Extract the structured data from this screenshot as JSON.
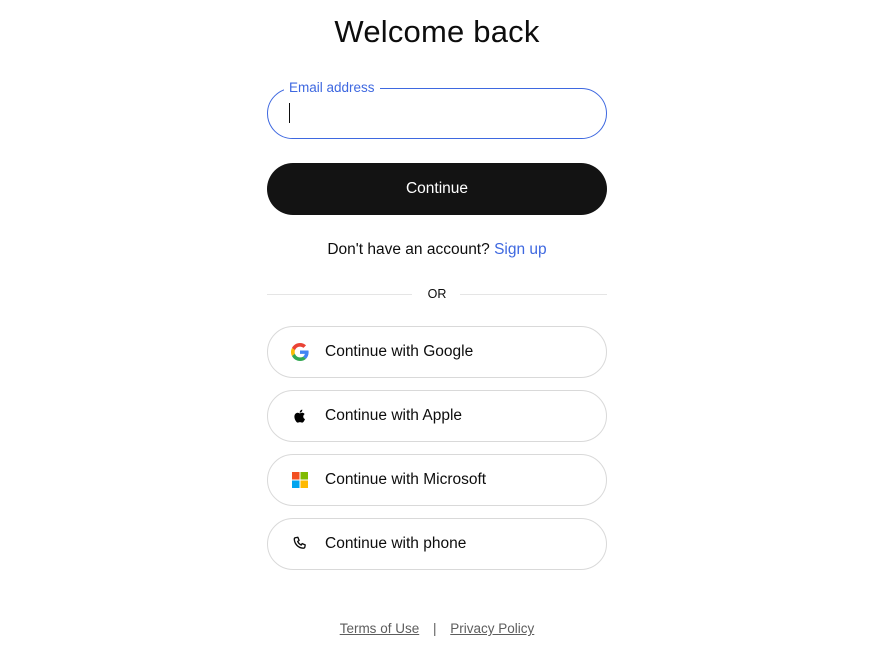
{
  "header": {
    "title": "Welcome back"
  },
  "email": {
    "label": "Email address",
    "value": "",
    "placeholder": ""
  },
  "continue_button": {
    "label": "Continue"
  },
  "signup": {
    "prompt": "Don't have an account?",
    "link_label": "Sign up"
  },
  "divider": {
    "label": "OR"
  },
  "social": [
    {
      "label": "Continue with Google",
      "icon": "google-icon"
    },
    {
      "label": "Continue with Apple",
      "icon": "apple-icon"
    },
    {
      "label": "Continue with Microsoft",
      "icon": "microsoft-icon"
    },
    {
      "label": "Continue with phone",
      "icon": "phone-icon"
    }
  ],
  "footer": {
    "terms": "Terms of Use",
    "separator": "|",
    "privacy": "Privacy Policy"
  },
  "colors": {
    "accent": "#3e68e0",
    "primary_button": "#131313",
    "border": "#d9d9d9"
  }
}
